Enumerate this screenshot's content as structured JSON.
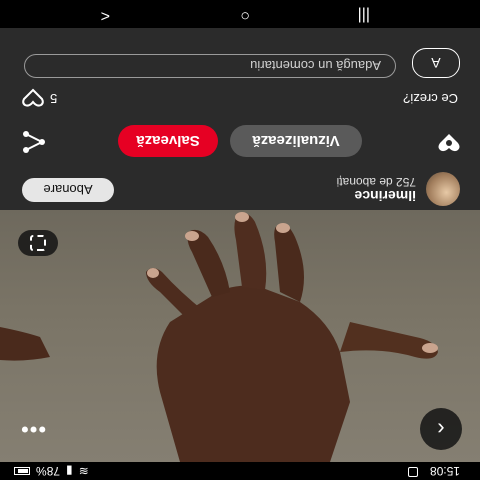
{
  "status_bar": {
    "time": "15:08",
    "battery": "78%"
  },
  "pin": {
    "more_label": "•••",
    "back_label": "‹"
  },
  "creator": {
    "name": "ilmerince",
    "followers": "752 de abonați",
    "follow_label": "Abonare"
  },
  "actions": {
    "visit_label": "Vizualizează",
    "save_label": "Salvează",
    "save_color": "#e60023"
  },
  "comments": {
    "title": "Ce crezi?",
    "count": "5",
    "avatar_letter": "A",
    "input_placeholder": "Adaugă un comentariu"
  },
  "nav": {
    "back": "<",
    "home": "○",
    "recents": "|||"
  }
}
